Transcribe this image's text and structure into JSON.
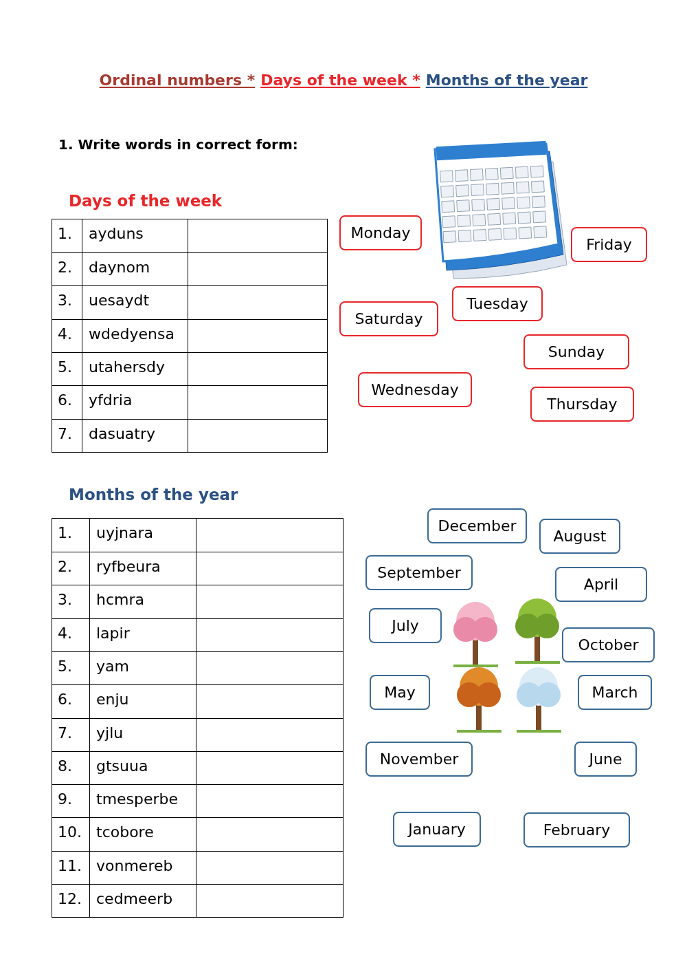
{
  "title": {
    "parts": [
      {
        "text": "Ordinal numbers *",
        "color": "#a83a32"
      },
      {
        "text": "Days of the week *",
        "color": "#e8262a"
      },
      {
        "text": "Months of the year",
        "color": "#2b5184"
      }
    ]
  },
  "instruction": "1. Write words in correct form:",
  "sections": [
    {
      "kind": "days",
      "heading": "Days of the week",
      "rows": [
        {
          "number": "1.",
          "word": "ayduns"
        },
        {
          "number": "2.",
          "word": "daynom"
        },
        {
          "number": "3.",
          "word": "uesaydt"
        },
        {
          "number": "4.",
          "word": "wdedyensa"
        },
        {
          "number": "5.",
          "word": "utahersdy"
        },
        {
          "number": "6.",
          "word": "yfdria"
        },
        {
          "number": "7.",
          "word": "dasuatry"
        }
      ],
      "word_cards": [
        "Monday",
        "Friday",
        "Tuesday",
        "Saturday",
        "Sunday",
        "Wednesday",
        "Thursday"
      ]
    },
    {
      "kind": "months",
      "heading": "Months of the year",
      "rows": [
        {
          "number": "1.",
          "word": "uyjnara"
        },
        {
          "number": "2.",
          "word": "ryfbeura"
        },
        {
          "number": "3.",
          "word": "hcmra"
        },
        {
          "number": "4.",
          "word": "lapir"
        },
        {
          "number": "5.",
          "word": "yam"
        },
        {
          "number": "6.",
          "word": "enju"
        },
        {
          "number": "7.",
          "word": "yjlu"
        },
        {
          "number": "8.",
          "word": "gtsuua"
        },
        {
          "number": "9.",
          "word": "tmesperbe"
        },
        {
          "number": "10.",
          "word": "tcobore"
        },
        {
          "number": "11.",
          "word": "vonmereb"
        },
        {
          "number": "12.",
          "word": "cedmeerb"
        }
      ],
      "word_cards": [
        "December",
        "August",
        "September",
        "April",
        "July",
        "October",
        "May",
        "March",
        "November",
        "June",
        "January",
        "February"
      ]
    }
  ]
}
